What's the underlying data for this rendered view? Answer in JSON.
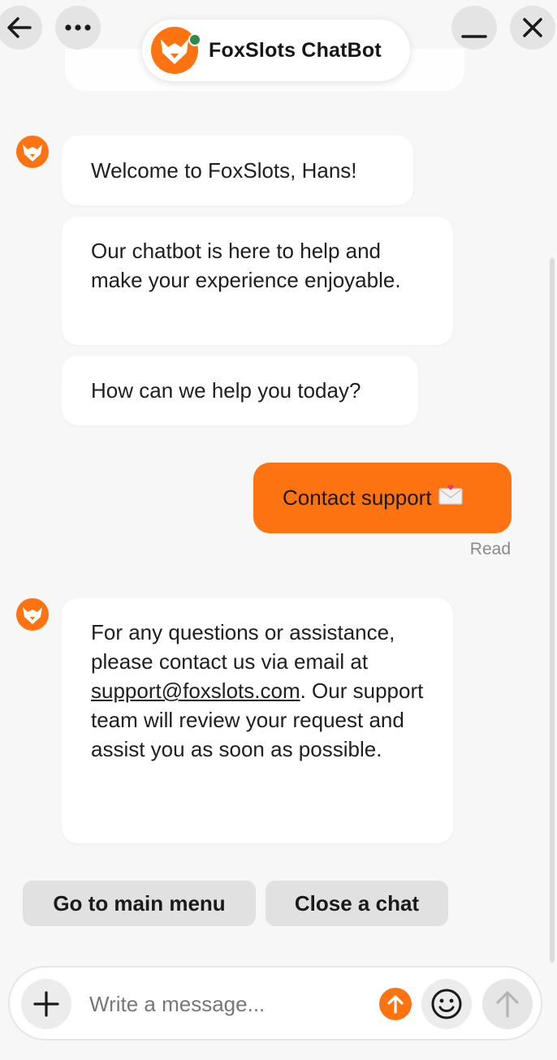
{
  "header": {
    "title": "FoxSlots ChatBot",
    "online_status_color": "#2f8a4e",
    "brand_color": "#fe7311",
    "icons": [
      "back-arrow-icon",
      "more-icon",
      "minimize-icon",
      "close-icon",
      "fox-logo-icon"
    ]
  },
  "messages": [
    {
      "sender": "bot",
      "text": "Welcome to FoxSlots, Hans!"
    },
    {
      "sender": "bot",
      "text": "Our chatbot is here to help and make your experience enjoyable."
    },
    {
      "sender": "bot",
      "text": "How can we help you today?"
    },
    {
      "sender": "user",
      "text": "Contact support",
      "icon": "envelope-icon",
      "status": "Read"
    },
    {
      "sender": "bot",
      "text_before": "For any questions or assistance, please contact us via email at ",
      "link": "support@foxslots.com",
      "text_after": ". Our support team will review your request and assist you as soon as possible."
    }
  ],
  "quick_replies": [
    {
      "label": "Go to main menu"
    },
    {
      "label": "Close a chat"
    }
  ],
  "composer": {
    "placeholder": "Write a message...",
    "icons": [
      "plus-icon",
      "upload-icon",
      "emoji-icon",
      "send-icon"
    ]
  }
}
